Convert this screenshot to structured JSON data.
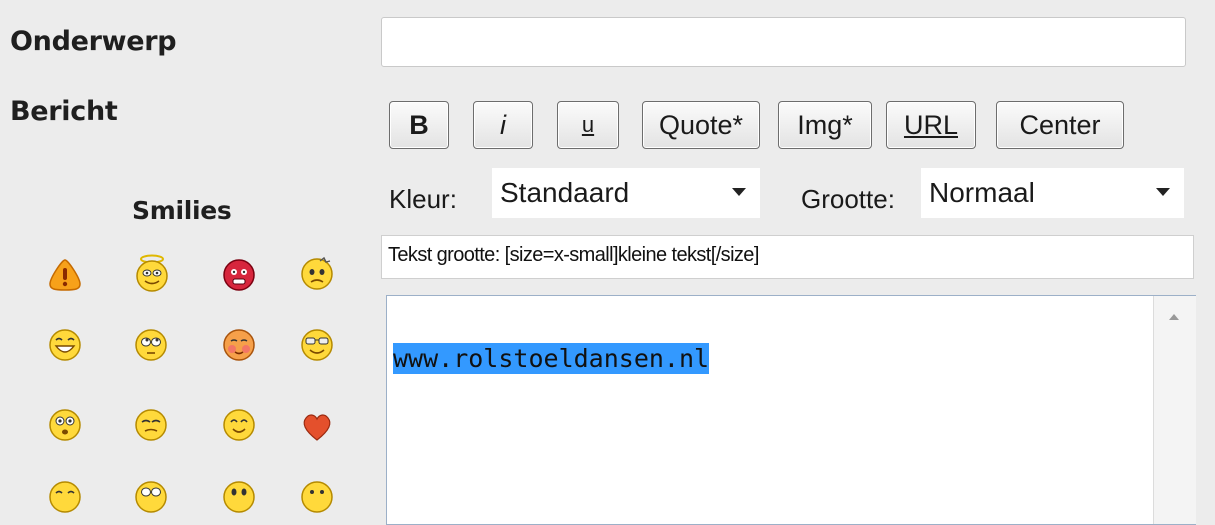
{
  "form": {
    "subject_label": "Onderwerp",
    "message_label": "Bericht",
    "subject_value": ""
  },
  "toolbar": {
    "buttons": [
      "B",
      "i",
      "u",
      "Quote*",
      "Img*",
      "URL",
      "Center"
    ]
  },
  "color": {
    "label": "Kleur:",
    "selected": "Standaard"
  },
  "size": {
    "label": "Grootte:",
    "selected": "Normaal"
  },
  "helpline": "Tekst grootte: [size=x-small]kleine tekst[/size]",
  "message": {
    "selected_text": "www.rolstoeldansen.nl"
  },
  "smilies": {
    "title": "Smilies",
    "icons": [
      "warning-icon",
      "angel-icon",
      "angry-red-icon",
      "confused-icon",
      "grin-icon",
      "rolling-eyes-icon",
      "blush-icon",
      "cool-icon",
      "shocked-icon",
      "wink-icon",
      "smile-icon",
      "heart-icon",
      "laugh-icon",
      "eek-icon",
      "sad-icon",
      "neutral-icon"
    ]
  },
  "colors": {
    "selection": "#3399ff",
    "background": "#ececec"
  }
}
